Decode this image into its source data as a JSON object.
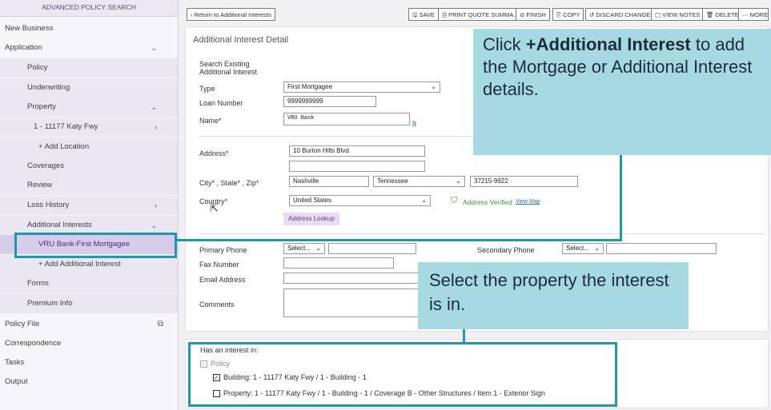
{
  "sidebar": {
    "header": "ADVANCED POLICY SEARCH",
    "items": [
      {
        "label": "New Business"
      },
      {
        "label": "Application"
      },
      {
        "label": "Policy"
      },
      {
        "label": "Underwriting"
      },
      {
        "label": "Property"
      },
      {
        "label": "1 - 11177 Katy Fwy"
      },
      {
        "label": "+ Add Location"
      },
      {
        "label": "Coverages"
      },
      {
        "label": "Review"
      },
      {
        "label": "Loss History"
      },
      {
        "label": "Additional Interests"
      },
      {
        "label": "VRU Bank-First Mortgagee"
      },
      {
        "label": "+ Add Additional Interest"
      },
      {
        "label": "Forms"
      },
      {
        "label": "Premium Info"
      },
      {
        "label": "Policy File"
      },
      {
        "label": "Correspondence"
      },
      {
        "label": "Tasks"
      },
      {
        "label": "Output"
      }
    ]
  },
  "toolbar": {
    "return": "‹ Return to Additional Interests",
    "save": "SAVE",
    "print": "PRINT QUOTE SUMMA...",
    "finish": "FINISH",
    "copy": "COPY",
    "discard": "DISCARD CHANGES",
    "notes": "VIEW NOTES",
    "delete": "DELETE",
    "more": "MORE"
  },
  "detail": {
    "title": "Additional Interest Detail",
    "search_existing": "Search Existing Additional Interest",
    "type_label": "Type",
    "type_value": "First Mortgagee",
    "loan_label": "Loan Number",
    "loan_value": "9999999999",
    "name_label": "Name*",
    "name_value": "VRU Bank",
    "address_label": "Address*",
    "address1": "10 Burton Hills Blvd",
    "address2": "",
    "csz_label": "City* , State* , Zip*",
    "city": "Nashville",
    "state": "Tennessee",
    "zip": "37215-9922",
    "country_label": "Country*",
    "country": "United States",
    "verified": "Address Verified",
    "view_map": "View Map",
    "lookup": "Address Lookup",
    "primary_phone": "Primary Phone",
    "primary_select": "Select...",
    "secondary_phone": "Secondary Phone",
    "secondary_select": "Select...",
    "fax": "Fax Number",
    "email": "Email Address",
    "comments": "Comments"
  },
  "interest": {
    "heading": "Has an interest in:",
    "policy": "Policy",
    "building": "Building: 1 - 11177 Katy Fwy / 1 - Building - 1",
    "property": "Property: 1 - 11177 Katy Fwy / 1 - Building - 1 / Coverage B - Other Structures / Item 1 - Exterior Sign"
  },
  "callouts": {
    "one_bold": "+Additional Interest",
    "one_pre": "Click ",
    "one_post": " to add the Mortgage or Additional Interest details.",
    "two": "Select the property the interest is in."
  },
  "colors": {
    "accent": "#1a9aab",
    "callout_bg": "#a7d9e2",
    "nav_selected": "#d7cce9"
  }
}
